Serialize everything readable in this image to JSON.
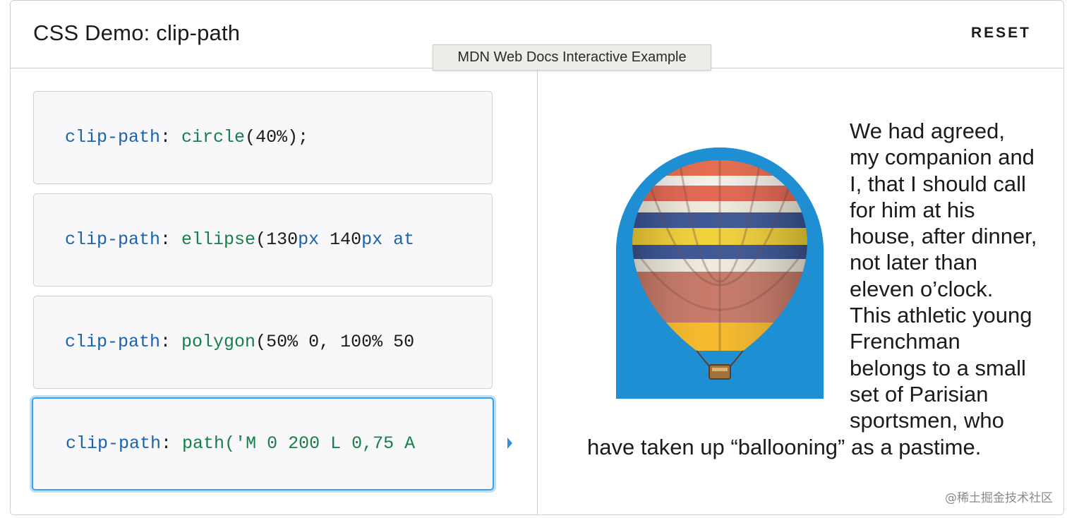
{
  "header": {
    "title": "CSS Demo: clip-path",
    "reset_label": "RESET"
  },
  "tooltip": "MDN Web Docs Interactive Example",
  "choices": [
    {
      "prop": "clip-path",
      "sep": ": ",
      "fn": "circle",
      "rest": "(40%);"
    },
    {
      "prop": "clip-path",
      "sep": ": ",
      "fn": "ellipse",
      "rest_parts": [
        "(130",
        "px",
        " 140",
        "px",
        " at"
      ]
    },
    {
      "prop": "clip-path",
      "sep": ": ",
      "fn": "polygon",
      "rest": "(50% 0, 100% 50"
    },
    {
      "prop": "clip-path",
      "sep": ": ",
      "fn": "path",
      "rest": "('M 0 200 L 0,75 A"
    }
  ],
  "selected_choice": 3,
  "output": {
    "image": "hot-air-balloon",
    "clip_shape": "path",
    "story_text": "We had agreed, my companion and I, that I should call for him at his house, after dinner, not later than eleven o’clock. This athletic young Frenchman belongs to a small set of Parisian sportsmen, who have taken up “ballooning” as a pastime."
  },
  "watermark": "@稀土掘金技术社区",
  "colors": {
    "property": "#1a63ad",
    "function": "#17804a",
    "selected_border": "#3f9fe8",
    "sky": "#1d8fd2"
  }
}
